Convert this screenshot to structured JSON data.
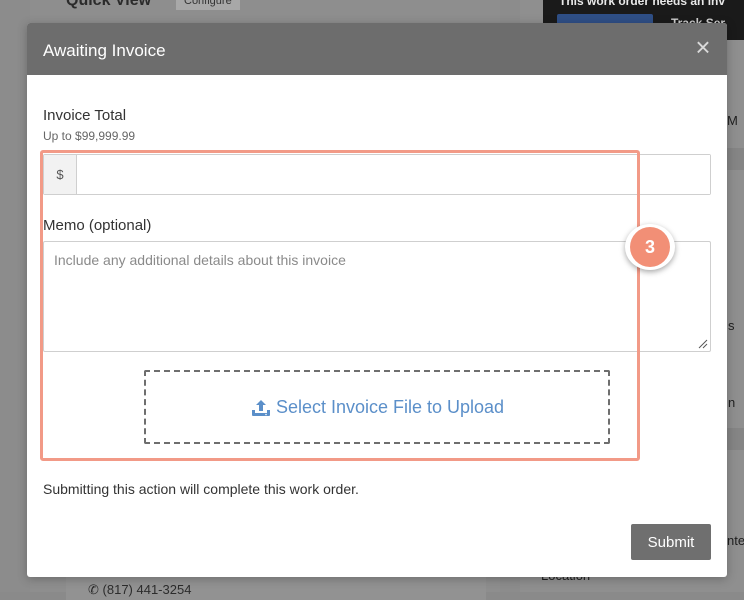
{
  "background": {
    "quick_view": "Quick View",
    "configure": "Configure",
    "banner_text": "This work order needs an inv",
    "banner_text2": "Track Ser",
    "right_text_1": "M",
    "right_text_2": "s",
    "right_text_3": "n",
    "right_text_4": "nte",
    "right_text_5": "Location",
    "phone": "(817) 441-3254"
  },
  "modal": {
    "title": "Awaiting Invoice",
    "close_glyph": "×",
    "invoice_total_label": "Invoice Total",
    "invoice_total_hint": "Up to $99,999.99",
    "currency_symbol": "$",
    "amount_value": "",
    "memo_label": "Memo (optional)",
    "memo_placeholder": "Include any additional details about this invoice",
    "upload_label": "Select Invoice File to Upload",
    "completion_note": "Submitting this action will complete this work order.",
    "submit_label": "Submit"
  },
  "annotation": {
    "step_number": "3"
  },
  "colors": {
    "header_bg": "#6d6d6d",
    "highlight": "#f29a87",
    "badge": "#f28f76",
    "link": "#5b8fc9",
    "submit_bg": "#6f6f6f"
  },
  "icons": [
    "close-icon",
    "upload-icon",
    "resize-grip-icon",
    "phone-icon"
  ]
}
